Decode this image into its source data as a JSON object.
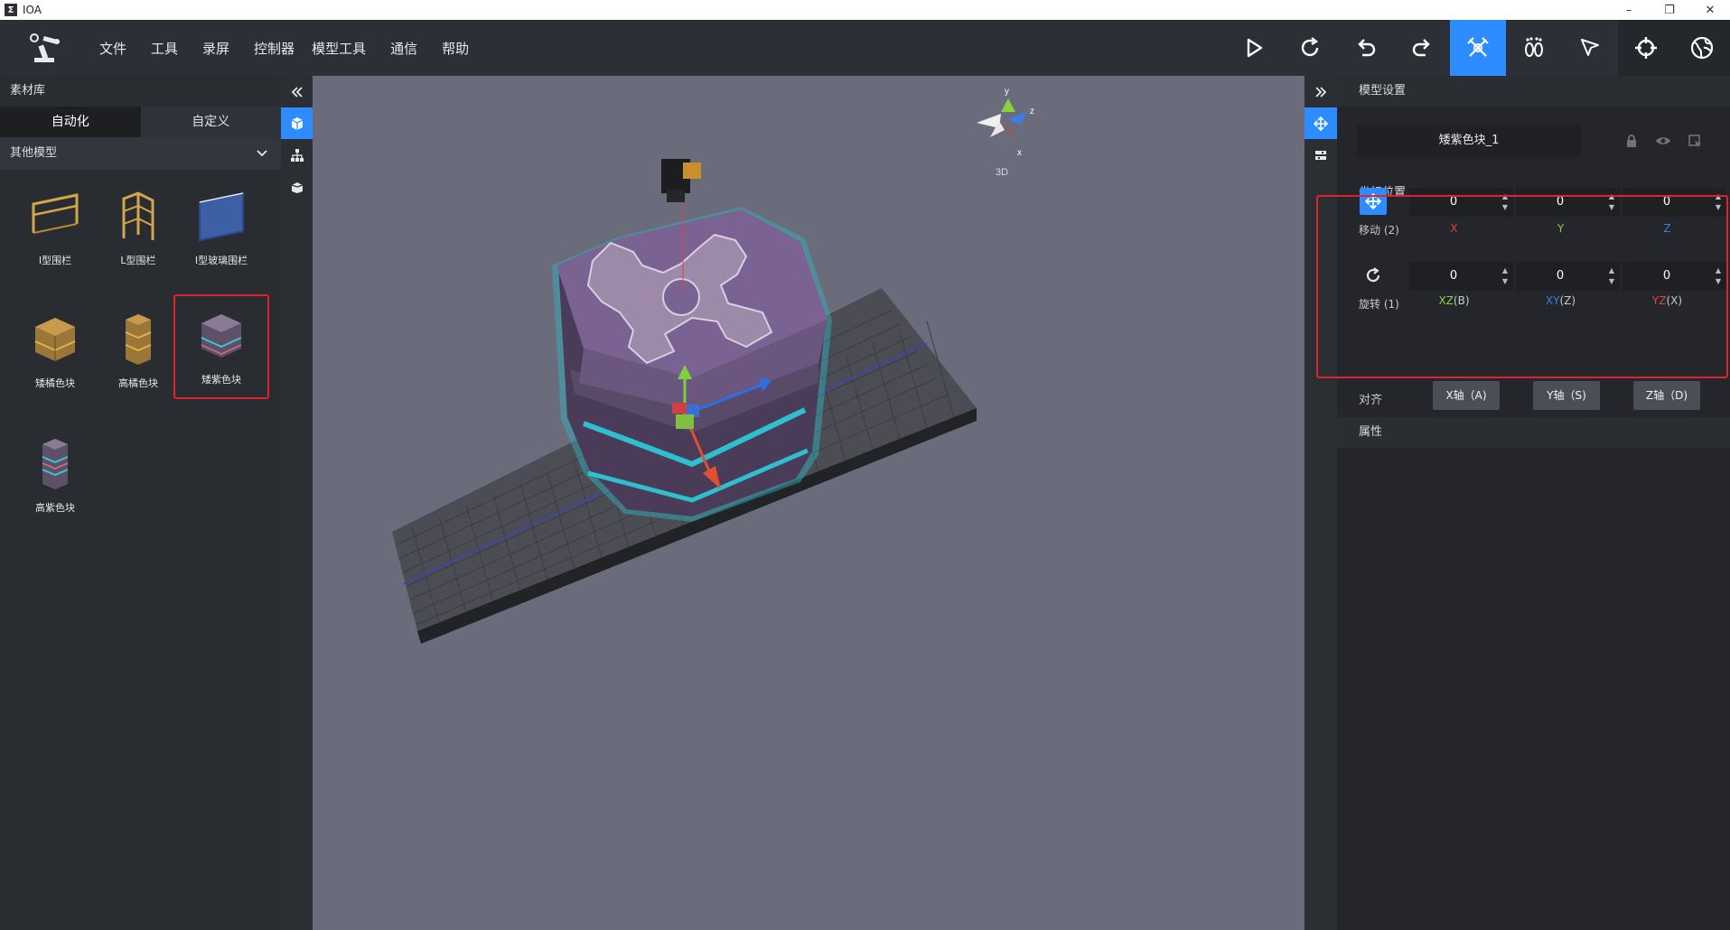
{
  "window": {
    "title": "IOA",
    "app_icon": "ioa-logo-icon"
  },
  "menu": [
    "文件",
    "工具",
    "录屏",
    "控制器",
    "模型工具",
    "通信",
    "帮助"
  ],
  "toolbar": {
    "items": [
      "play-icon",
      "refresh-icon",
      "undo-icon",
      "redo-icon",
      "robot-arm-icon",
      "footprint-icon",
      "pointer-icon",
      "crosshair-icon",
      "globe-icon"
    ],
    "active": "robot-arm-icon"
  },
  "library": {
    "title": "素材库",
    "tabs": [
      "自动化",
      "自定义"
    ],
    "active_tab": "自动化",
    "category": "其他模型",
    "assets": [
      {
        "label": "I型围栏",
        "icon": "i-fence-icon"
      },
      {
        "label": "L型围栏",
        "icon": "l-fence-icon"
      },
      {
        "label": "I型玻璃围栏",
        "icon": "glass-fence-icon"
      },
      {
        "label": "矮橘色块",
        "icon": "short-orange-block-icon"
      },
      {
        "label": "高橘色块",
        "icon": "tall-orange-block-icon"
      },
      {
        "label": "矮紫色块",
        "icon": "short-purple-block-icon",
        "selected": true
      },
      {
        "label": "高紫色块",
        "icon": "tall-purple-block-icon"
      }
    ]
  },
  "viewport": {
    "gizmo_label": "3D",
    "axes": [
      "y",
      "z",
      "x"
    ]
  },
  "properties": {
    "title": "模型设置",
    "model_name": "矮紫色块_1",
    "coord_title": "坐标位置",
    "move": {
      "label": "移动 (2)",
      "x": "0",
      "y": "0",
      "z": "0",
      "x_label": "X",
      "y_label": "Y",
      "z_label": "Z"
    },
    "rotate": {
      "label": "旋转 (1)",
      "xz": "0",
      "xy": "0",
      "yz": "0",
      "xz_axis": "XZ",
      "xz_key": "(B)",
      "xy_axis": "XY",
      "xy_key": "(Z)",
      "yz_axis": "YZ",
      "yz_key": "(X)"
    },
    "align": {
      "label": "对齐",
      "buttons": [
        "X轴（A)",
        "Y轴（S)",
        "Z轴（D)"
      ]
    },
    "attributes_title": "属性"
  },
  "colors": {
    "accent": "#2d8cff",
    "highlight": "#e0232a",
    "x_axis": "#e0443a",
    "y_axis": "#8bd33b",
    "z_axis": "#3a7fe6"
  }
}
